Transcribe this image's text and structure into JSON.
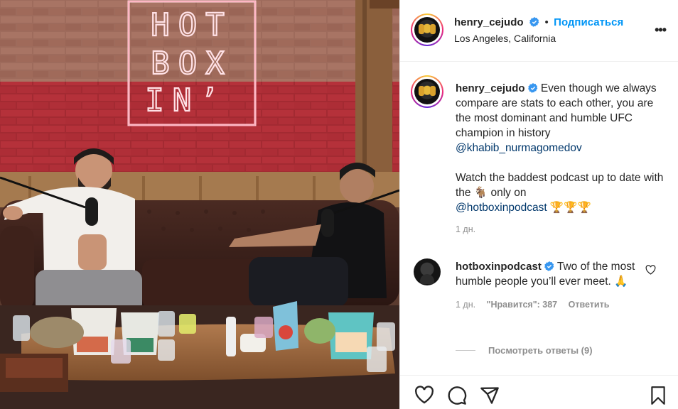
{
  "neon_sign": {
    "line1": "HOT",
    "line2": "BOX",
    "line3": "IN’"
  },
  "post": {
    "author": {
      "username": "henry_cejudo",
      "verified": true,
      "follow_label": "Подписаться",
      "location": "Los Angeles, California"
    },
    "more_label": "•••",
    "caption": {
      "username": "henry_cejudo",
      "text_1": " Even though we always compare are stats to each other, you are the most dominant and humble UFC champion in history ",
      "mention_1": "@khabib_nurmagomedov",
      "text_2": "Watch the baddest podcast up to date with the ",
      "emoji_1": "🐐",
      "text_3": " only on",
      "mention_2": "@hotboxinpodcast",
      "emoji_2": " 🏆🏆🏆",
      "time": "1 дн."
    },
    "comment": {
      "username": "hotboxinpodcast",
      "text": " Two of the most humble people you’ll ever meet. ",
      "emoji": "🙏",
      "time": "1 дн.",
      "likes": "\"Нравится\": 387",
      "reply_label": "Ответить",
      "view_replies": "Посмотреть ответы (9)"
    },
    "icons": {
      "like": "heart-icon",
      "comment": "comment-icon",
      "share": "share-icon",
      "save": "bookmark-icon"
    },
    "colors": {
      "link": "#0095f6",
      "mention": "#00376b",
      "verified": "#3897f0",
      "muted": "#8e8e8e"
    }
  }
}
